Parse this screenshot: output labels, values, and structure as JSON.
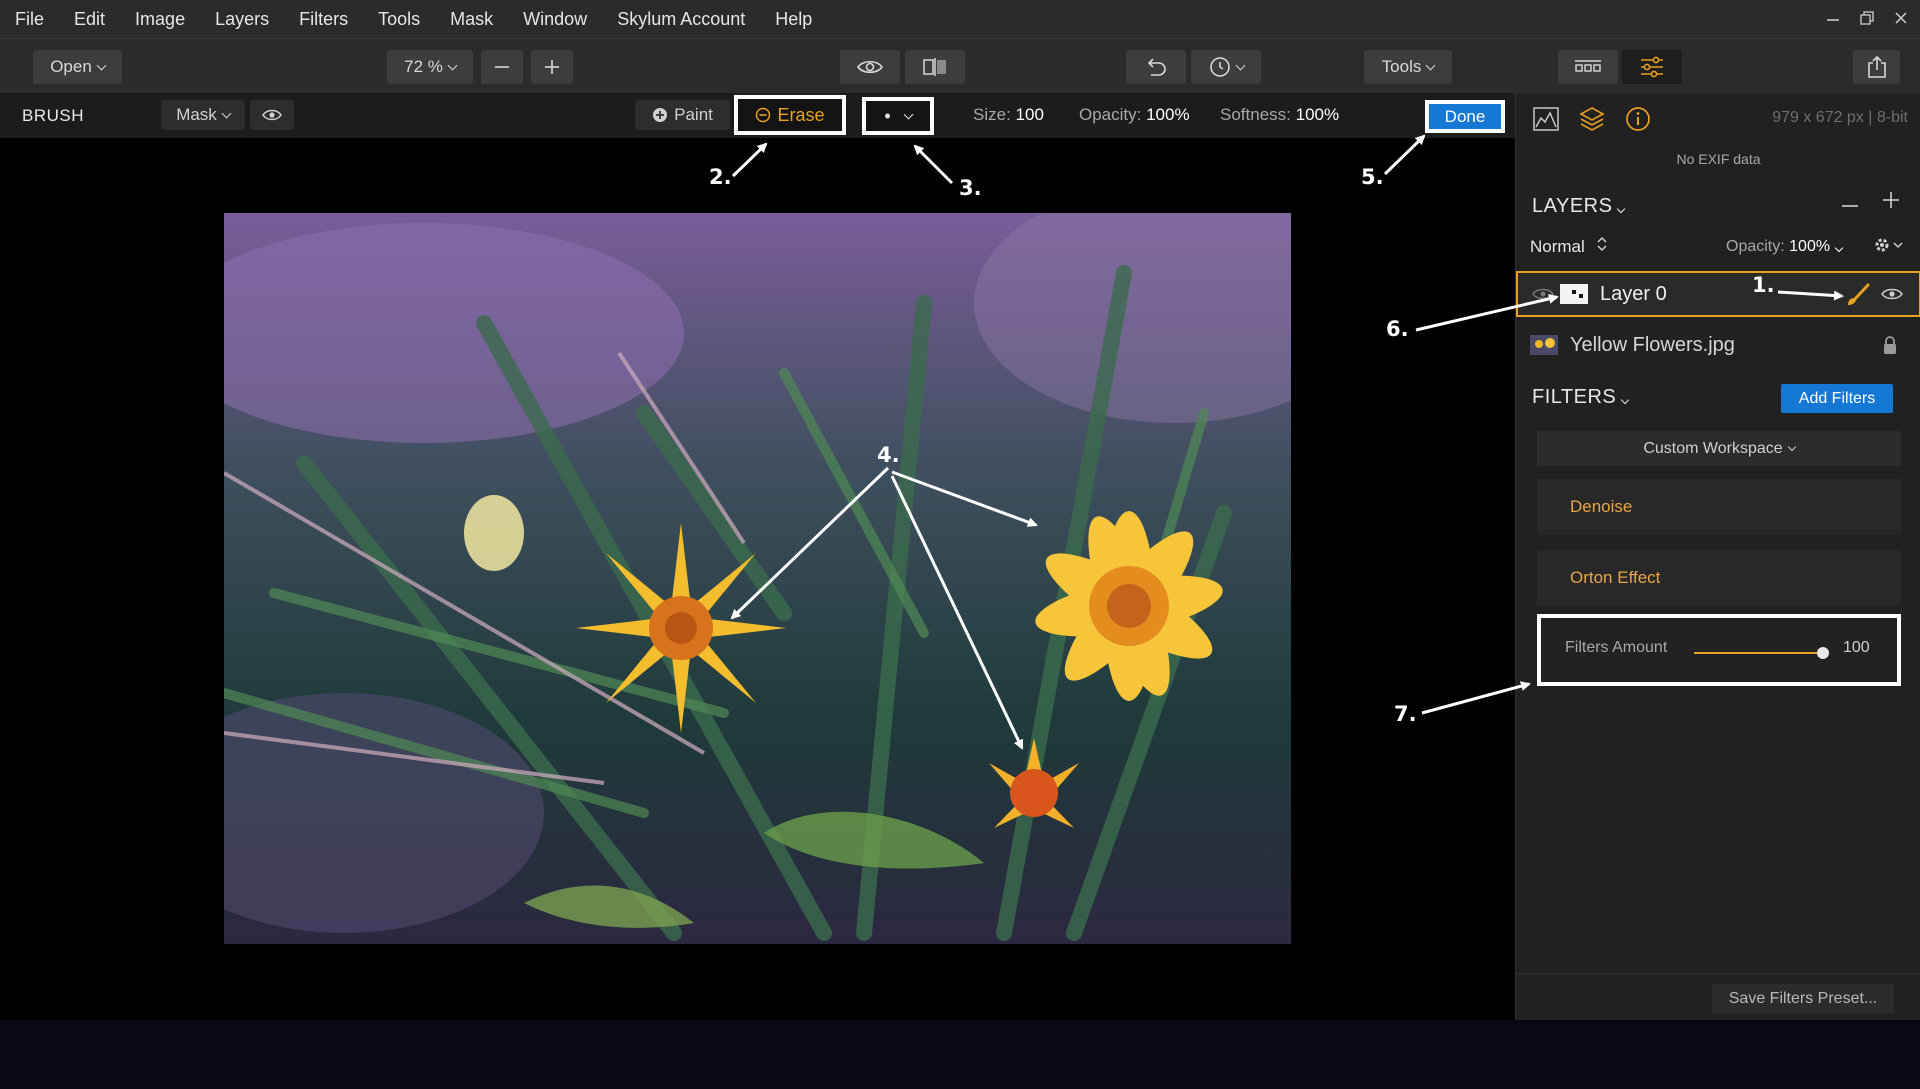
{
  "menu": {
    "items": [
      "File",
      "Edit",
      "Image",
      "Layers",
      "Filters",
      "Tools",
      "Mask",
      "Window",
      "Skylum Account",
      "Help"
    ]
  },
  "toolbar": {
    "open_label": "Open",
    "zoom_value": "72 %",
    "tools_label": "Tools"
  },
  "brush_bar": {
    "mode_label": "BRUSH",
    "mask_label": "Mask",
    "paint_label": "Paint",
    "erase_label": "Erase",
    "brush_symbol": "•",
    "size_label": "Size:",
    "size_value": "100",
    "opacity_label": "Opacity:",
    "opacity_value": "100%",
    "softness_label": "Softness:",
    "softness_value": "100%",
    "done_label": "Done"
  },
  "panel": {
    "image_info": "979 x 672 px  |  8-bit",
    "exif_text": "No EXIF data",
    "layers_title": "LAYERS",
    "blend_mode": "Normal",
    "opacity_label": "Opacity:",
    "opacity_value": "100%",
    "layers": [
      {
        "name": "Layer 0"
      },
      {
        "name": "Yellow Flowers.jpg"
      }
    ],
    "filters_title": "FILTERS",
    "add_filters_label": "Add Filters",
    "workspace_label": "Custom Workspace",
    "filters": [
      {
        "name": "Denoise"
      },
      {
        "name": "Orton Effect"
      }
    ],
    "filters_amount_label": "Filters Amount",
    "filters_amount_value": "100",
    "save_preset_label": "Save Filters Preset..."
  },
  "annotations": [
    "1.",
    "2.",
    "3.",
    "4.",
    "5.",
    "6.",
    "7."
  ],
  "colors": {
    "accent_orange": "#e8a023",
    "accent_blue": "#1478d4",
    "panel_bg": "#212121",
    "toolbar_bg": "#2b2b2b"
  }
}
